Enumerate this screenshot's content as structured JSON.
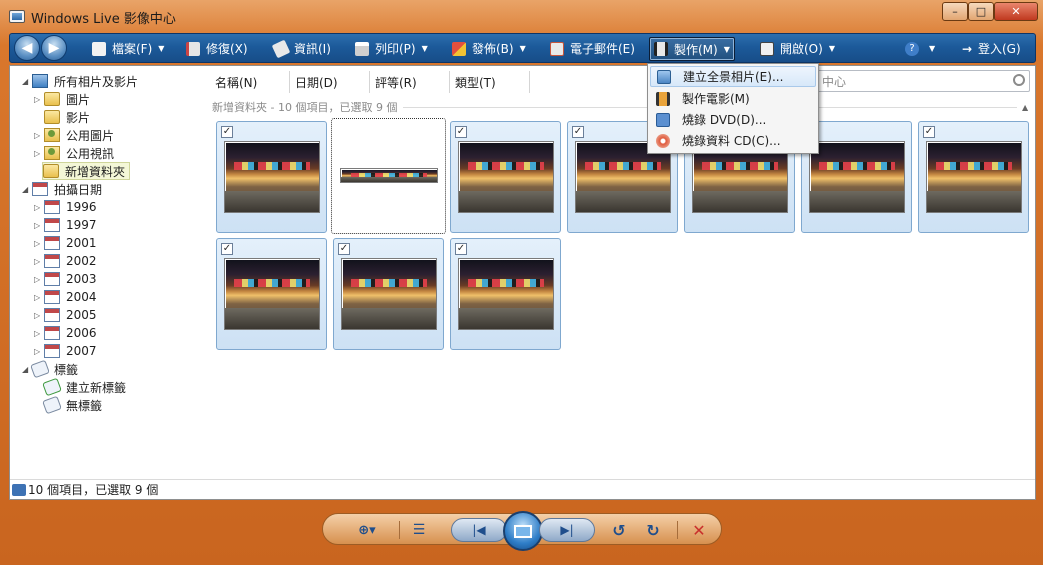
{
  "window": {
    "title": "Windows Live 影像中心",
    "min_label": "–",
    "max_label": "□",
    "close_label": "✕"
  },
  "toolbar": {
    "back_label": "◀",
    "forward_label": "▶",
    "items": [
      {
        "label": "檔案(F)",
        "icon": "file-icon",
        "has_caret": true
      },
      {
        "label": "修復(X)",
        "icon": "fix-icon",
        "has_caret": false
      },
      {
        "label": "資訊(I)",
        "icon": "info-tag-icon",
        "has_caret": false
      },
      {
        "label": "列印(P)",
        "icon": "printer-icon",
        "has_caret": true
      },
      {
        "label": "發佈(B)",
        "icon": "publish-icon",
        "has_caret": true
      },
      {
        "label": "電子郵件(E)",
        "icon": "email-icon",
        "has_caret": false
      },
      {
        "label": "製作(M)",
        "icon": "make-icon",
        "has_caret": true,
        "active": true
      },
      {
        "label": "開啟(O)",
        "icon": "open-icon",
        "has_caret": true
      }
    ],
    "help_label": "?",
    "login_label": "登入(G)"
  },
  "tree": {
    "all_label": "所有相片及影片",
    "pictures_label": "圖片",
    "videos_label": "影片",
    "public_pictures_label": "公用圖片",
    "public_videos_label": "公用視訊",
    "new_folder_label": "新增資料夾",
    "date_taken_label": "拍攝日期",
    "years": [
      "1996",
      "1997",
      "2001",
      "2002",
      "2003",
      "2004",
      "2005",
      "2006",
      "2007"
    ],
    "tags_label": "標籤",
    "new_tag_label": "建立新標籤",
    "no_tag_label": "無標籤"
  },
  "columns": {
    "name": "名稱(N)",
    "date": "日期(D)",
    "rating": "評等(R)",
    "type": "類型(T)"
  },
  "search": {
    "placeholder_visible": "中心"
  },
  "group": {
    "header": "新增資料夾 - 10 個項目，已選取 9 個"
  },
  "menu": {
    "items": [
      {
        "label": "建立全景相片(E)...",
        "icon": "panorama-icon",
        "highlighted": true
      },
      {
        "label": "製作電影(M)",
        "icon": "movie-icon",
        "highlighted": false
      },
      {
        "label": "燒錄 DVD(D)...",
        "icon": "dvd-icon",
        "highlighted": false
      },
      {
        "label": "燒錄資料 CD(C)...",
        "icon": "cd-icon",
        "highlighted": false
      }
    ]
  },
  "thumbnails": [
    {
      "selected": true
    },
    {
      "selected": false,
      "panorama": true
    },
    {
      "selected": true
    },
    {
      "selected": true
    },
    {
      "selected": true
    },
    {
      "selected": true
    },
    {
      "selected": true
    },
    {
      "selected": true
    },
    {
      "selected": true
    },
    {
      "selected": true
    }
  ],
  "status": {
    "text": "10 個項目，已選取 9 個"
  },
  "bottombar": {
    "zoom_label": "⊕▾",
    "details_label": "☰",
    "prev_label": "|◀",
    "next_label": "▶|",
    "rotate_ccw_label": "↺",
    "rotate_cw_label": "↻",
    "delete_label": "✕"
  },
  "colors": {
    "toolbar": "#1c5a9a",
    "frame": "#d9772c",
    "selection": "#cde1f4"
  }
}
